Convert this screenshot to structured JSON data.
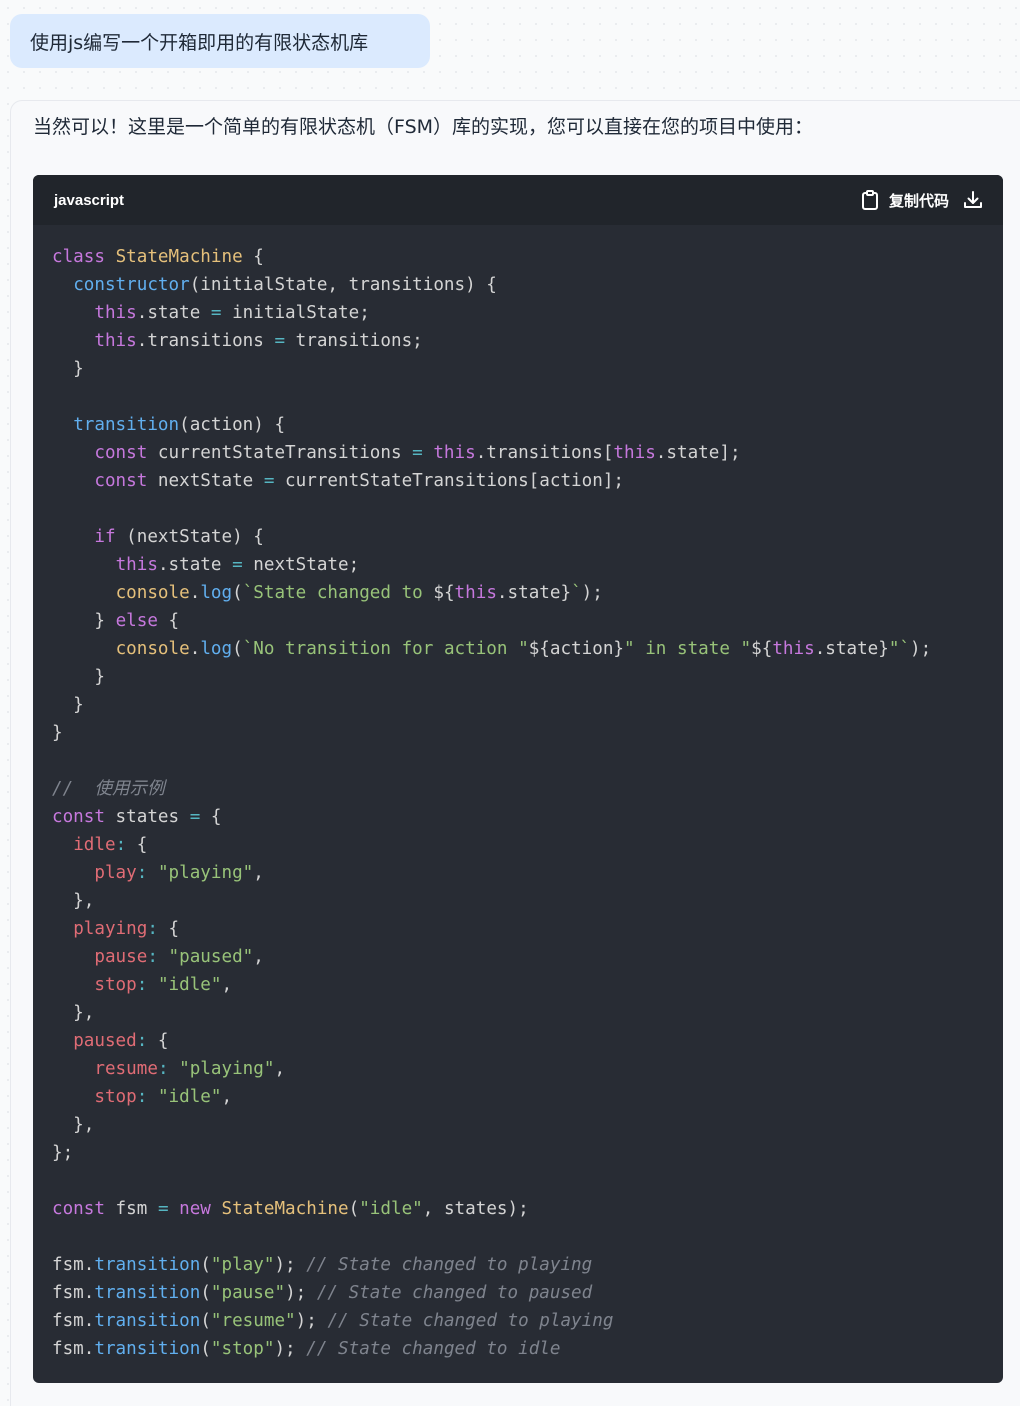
{
  "user_message": {
    "text": "使用js编写一个开箱即用的有限状态机库"
  },
  "assistant_message": {
    "intro": "当然可以！这里是一个简单的有限状态机（FSM）库的实现，您可以直接在您的项目中使用："
  },
  "code_block": {
    "language": "javascript",
    "copy_label": "复制代码",
    "copy_icon": "clipboard-icon",
    "download_icon": "download-icon",
    "lines": [
      [
        [
          "kw",
          "class"
        ],
        [
          "plain",
          " "
        ],
        [
          "cls",
          "StateMachine"
        ],
        [
          "plain",
          " {"
        ]
      ],
      [
        [
          "plain",
          "  "
        ],
        [
          "fn",
          "constructor"
        ],
        [
          "plain",
          "(initialState, transitions) {"
        ]
      ],
      [
        [
          "plain",
          "    "
        ],
        [
          "this",
          "this"
        ],
        [
          "plain",
          ".state "
        ],
        [
          "op",
          "="
        ],
        [
          "plain",
          " initialState;"
        ]
      ],
      [
        [
          "plain",
          "    "
        ],
        [
          "this",
          "this"
        ],
        [
          "plain",
          ".transitions "
        ],
        [
          "op",
          "="
        ],
        [
          "plain",
          " transitions;"
        ]
      ],
      [
        [
          "plain",
          "  }"
        ]
      ],
      [],
      [
        [
          "plain",
          "  "
        ],
        [
          "fn",
          "transition"
        ],
        [
          "plain",
          "(action) {"
        ]
      ],
      [
        [
          "plain",
          "    "
        ],
        [
          "kw",
          "const"
        ],
        [
          "plain",
          " currentStateTransitions "
        ],
        [
          "op",
          "="
        ],
        [
          "plain",
          " "
        ],
        [
          "this",
          "this"
        ],
        [
          "plain",
          ".transitions["
        ],
        [
          "this",
          "this"
        ],
        [
          "plain",
          ".state];"
        ]
      ],
      [
        [
          "plain",
          "    "
        ],
        [
          "kw",
          "const"
        ],
        [
          "plain",
          " nextState "
        ],
        [
          "op",
          "="
        ],
        [
          "plain",
          " currentStateTransitions[action];"
        ]
      ],
      [],
      [
        [
          "plain",
          "    "
        ],
        [
          "kw",
          "if"
        ],
        [
          "plain",
          " (nextState) {"
        ]
      ],
      [
        [
          "plain",
          "      "
        ],
        [
          "this",
          "this"
        ],
        [
          "plain",
          ".state "
        ],
        [
          "op",
          "="
        ],
        [
          "plain",
          " nextState;"
        ]
      ],
      [
        [
          "plain",
          "      "
        ],
        [
          "cls",
          "console"
        ],
        [
          "plain",
          "."
        ],
        [
          "fn",
          "log"
        ],
        [
          "plain",
          "("
        ],
        [
          "str",
          "`State changed to "
        ],
        [
          "plain",
          "${"
        ],
        [
          "this",
          "this"
        ],
        [
          "plain",
          ".state}"
        ],
        [
          "str",
          "`"
        ],
        [
          "plain",
          ");"
        ]
      ],
      [
        [
          "plain",
          "    } "
        ],
        [
          "kw",
          "else"
        ],
        [
          "plain",
          " {"
        ]
      ],
      [
        [
          "plain",
          "      "
        ],
        [
          "cls",
          "console"
        ],
        [
          "plain",
          "."
        ],
        [
          "fn",
          "log"
        ],
        [
          "plain",
          "("
        ],
        [
          "str",
          "`No transition for action \""
        ],
        [
          "plain",
          "${action}"
        ],
        [
          "str",
          "\" in state \""
        ],
        [
          "plain",
          "${"
        ],
        [
          "this",
          "this"
        ],
        [
          "plain",
          ".state}"
        ],
        [
          "str",
          "\"`"
        ],
        [
          "plain",
          ");"
        ]
      ],
      [
        [
          "plain",
          "    }"
        ]
      ],
      [
        [
          "plain",
          "  }"
        ]
      ],
      [
        [
          "plain",
          "}"
        ]
      ],
      [],
      [
        [
          "cmt",
          "//  使用示例"
        ]
      ],
      [
        [
          "kw",
          "const"
        ],
        [
          "plain",
          " states "
        ],
        [
          "op",
          "="
        ],
        [
          "plain",
          " {"
        ]
      ],
      [
        [
          "plain",
          "  "
        ],
        [
          "prop",
          "idle"
        ],
        [
          "op",
          ":"
        ],
        [
          "plain",
          " {"
        ]
      ],
      [
        [
          "plain",
          "    "
        ],
        [
          "prop",
          "play"
        ],
        [
          "op",
          ":"
        ],
        [
          "plain",
          " "
        ],
        [
          "str",
          "\"playing\""
        ],
        [
          "plain",
          ","
        ]
      ],
      [
        [
          "plain",
          "  },"
        ]
      ],
      [
        [
          "plain",
          "  "
        ],
        [
          "prop",
          "playing"
        ],
        [
          "op",
          ":"
        ],
        [
          "plain",
          " {"
        ]
      ],
      [
        [
          "plain",
          "    "
        ],
        [
          "prop",
          "pause"
        ],
        [
          "op",
          ":"
        ],
        [
          "plain",
          " "
        ],
        [
          "str",
          "\"paused\""
        ],
        [
          "plain",
          ","
        ]
      ],
      [
        [
          "plain",
          "    "
        ],
        [
          "prop",
          "stop"
        ],
        [
          "op",
          ":"
        ],
        [
          "plain",
          " "
        ],
        [
          "str",
          "\"idle\""
        ],
        [
          "plain",
          ","
        ]
      ],
      [
        [
          "plain",
          "  },"
        ]
      ],
      [
        [
          "plain",
          "  "
        ],
        [
          "prop",
          "paused"
        ],
        [
          "op",
          ":"
        ],
        [
          "plain",
          " {"
        ]
      ],
      [
        [
          "plain",
          "    "
        ],
        [
          "prop",
          "resume"
        ],
        [
          "op",
          ":"
        ],
        [
          "plain",
          " "
        ],
        [
          "str",
          "\"playing\""
        ],
        [
          "plain",
          ","
        ]
      ],
      [
        [
          "plain",
          "    "
        ],
        [
          "prop",
          "stop"
        ],
        [
          "op",
          ":"
        ],
        [
          "plain",
          " "
        ],
        [
          "str",
          "\"idle\""
        ],
        [
          "plain",
          ","
        ]
      ],
      [
        [
          "plain",
          "  },"
        ]
      ],
      [
        [
          "plain",
          "};"
        ]
      ],
      [],
      [
        [
          "kw",
          "const"
        ],
        [
          "plain",
          " fsm "
        ],
        [
          "op",
          "="
        ],
        [
          "plain",
          " "
        ],
        [
          "kw",
          "new"
        ],
        [
          "plain",
          " "
        ],
        [
          "cls",
          "StateMachine"
        ],
        [
          "plain",
          "("
        ],
        [
          "str",
          "\"idle\""
        ],
        [
          "plain",
          ", states);"
        ]
      ],
      [],
      [
        [
          "plain",
          "fsm."
        ],
        [
          "fn",
          "transition"
        ],
        [
          "plain",
          "("
        ],
        [
          "str",
          "\"play\""
        ],
        [
          "plain",
          "); "
        ],
        [
          "cmt",
          "// State changed to playing"
        ]
      ],
      [
        [
          "plain",
          "fsm."
        ],
        [
          "fn",
          "transition"
        ],
        [
          "plain",
          "("
        ],
        [
          "str",
          "\"pause\""
        ],
        [
          "plain",
          "); "
        ],
        [
          "cmt",
          "// State changed to paused"
        ]
      ],
      [
        [
          "plain",
          "fsm."
        ],
        [
          "fn",
          "transition"
        ],
        [
          "plain",
          "("
        ],
        [
          "str",
          "\"resume\""
        ],
        [
          "plain",
          "); "
        ],
        [
          "cmt",
          "// State changed to playing"
        ]
      ],
      [
        [
          "plain",
          "fsm."
        ],
        [
          "fn",
          "transition"
        ],
        [
          "plain",
          "("
        ],
        [
          "str",
          "\"stop\""
        ],
        [
          "plain",
          "); "
        ],
        [
          "cmt",
          "// State changed to idle"
        ]
      ]
    ]
  }
}
